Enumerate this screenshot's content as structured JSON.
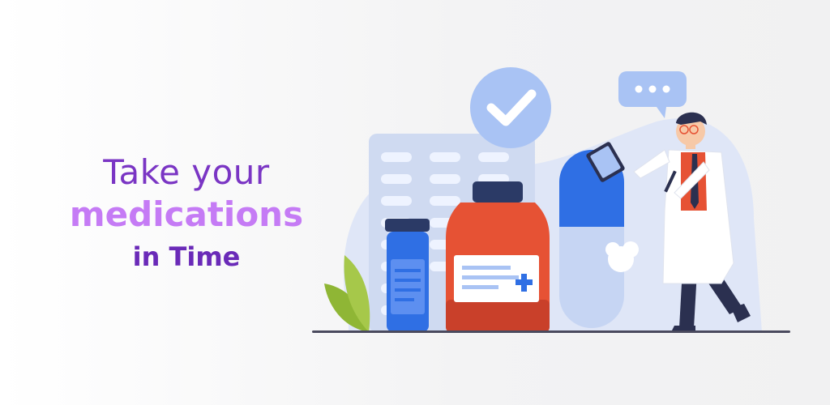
{
  "headline": {
    "line1": "Take your",
    "line2": "medications",
    "line3": "in Time"
  },
  "illustration": {
    "icons": [
      "check-icon",
      "chat-dots-icon",
      "plus-icon"
    ],
    "colors": {
      "purple": "#7a35c4",
      "lilac": "#c57bf5",
      "blue": "#2f6fe4",
      "light_blue": "#a9c6f5",
      "red_bottle": "#e65234",
      "leaf": "#9bbf3a",
      "ground": "#4a4a5e"
    }
  }
}
